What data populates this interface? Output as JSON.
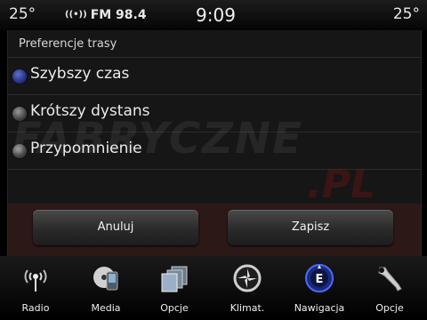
{
  "status": {
    "temp_left": "25°",
    "radio": "FM 98.4",
    "time": "9:09",
    "temp_right": "25°"
  },
  "panel": {
    "title": "Preferencje trasy",
    "options": [
      {
        "label": "Szybszy czas",
        "selected": true
      },
      {
        "label": "Krótszy dystans",
        "selected": false
      },
      {
        "label": "Przypomnienie",
        "selected": false
      }
    ]
  },
  "watermark": {
    "line1": "FABRYCZNE",
    "line2": ".PL"
  },
  "buttons": {
    "cancel": "Anuluj",
    "save": "Zapisz"
  },
  "nav": [
    {
      "label": "Radio",
      "icon": "radio-icon"
    },
    {
      "label": "Media",
      "icon": "media-icon"
    },
    {
      "label": "Opcje",
      "icon": "apps-icon"
    },
    {
      "label": "Klimat.",
      "icon": "climate-icon"
    },
    {
      "label": "Nawigacja",
      "icon": "compass-icon"
    },
    {
      "label": "Opcje",
      "icon": "wrench-icon"
    }
  ],
  "colors": {
    "accent": "#2b3ea8",
    "button_bar": "#2d1818"
  }
}
